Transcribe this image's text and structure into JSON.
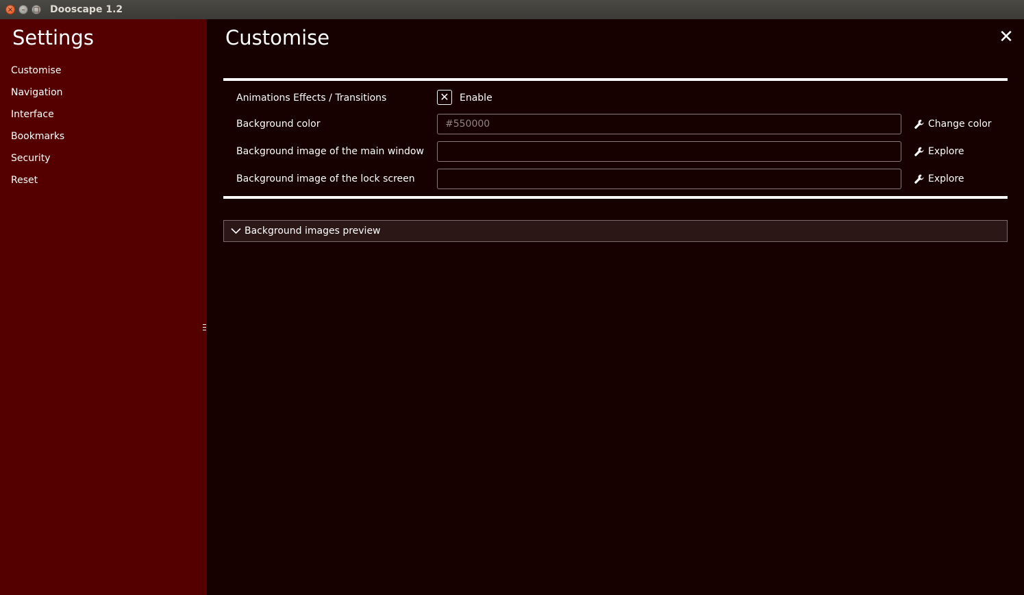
{
  "window": {
    "title": "Dooscape 1.2",
    "close_glyph": "×",
    "minimize_glyph": "–",
    "maximize_glyph": "□"
  },
  "sidebar": {
    "heading": "Settings",
    "items": [
      {
        "label": "Customise"
      },
      {
        "label": "Navigation"
      },
      {
        "label": "Interface"
      },
      {
        "label": "Bookmarks"
      },
      {
        "label": "Security"
      },
      {
        "label": "Reset"
      }
    ]
  },
  "main": {
    "heading": "Customise",
    "close_glyph": "✕",
    "settings": {
      "animations": {
        "label": "Animations Effects / Transitions",
        "checkbox_glyph": "✕",
        "checkbox_label": "Enable",
        "checked": true
      },
      "background_color": {
        "label": "Background color",
        "value": "",
        "placeholder": "#550000",
        "action_label": "Change color",
        "action_icon": "wrench-icon"
      },
      "main_window_image": {
        "label": "Background image of the main window",
        "value": "",
        "placeholder": "",
        "action_label": "Explore",
        "action_icon": "wrench-icon"
      },
      "lock_screen_image": {
        "label": "Background image of the lock screen",
        "value": "",
        "placeholder": "",
        "action_label": "Explore",
        "action_icon": "wrench-icon"
      }
    },
    "preview": {
      "label": "Background images preview",
      "icon": "chevron-down-icon"
    }
  },
  "colors": {
    "sidebar_bg": "#550000",
    "main_bg": "#160000",
    "text": "#ffffff",
    "placeholder": "#8f8585"
  }
}
